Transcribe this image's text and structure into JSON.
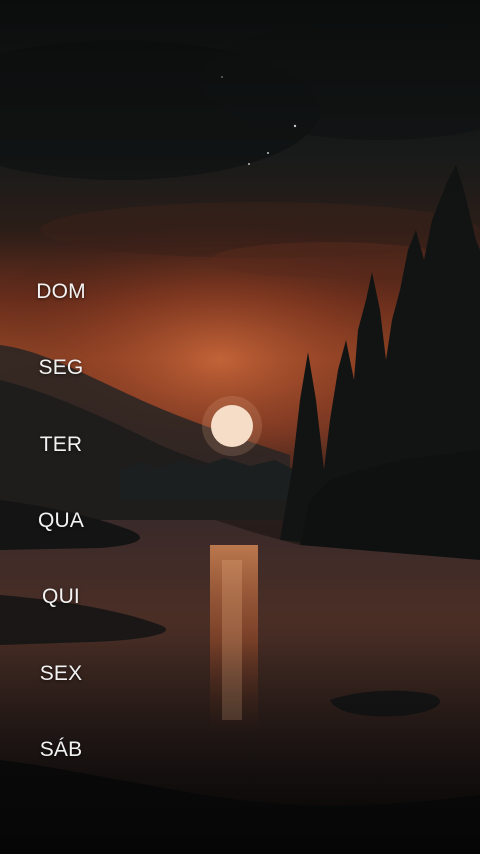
{
  "wallpaper": {
    "scene": "sunset-lake-forest"
  },
  "day_selector": {
    "items": [
      {
        "label": "DOM"
      },
      {
        "label": "SEG"
      },
      {
        "label": "TER"
      },
      {
        "label": "QUA"
      },
      {
        "label": "QUI"
      },
      {
        "label": "SEX"
      },
      {
        "label": "SÁB"
      }
    ]
  },
  "colors": {
    "label_text": "#f2f2f2",
    "sun": "#f7e6d4",
    "sky_glow": "#9c4a26"
  }
}
